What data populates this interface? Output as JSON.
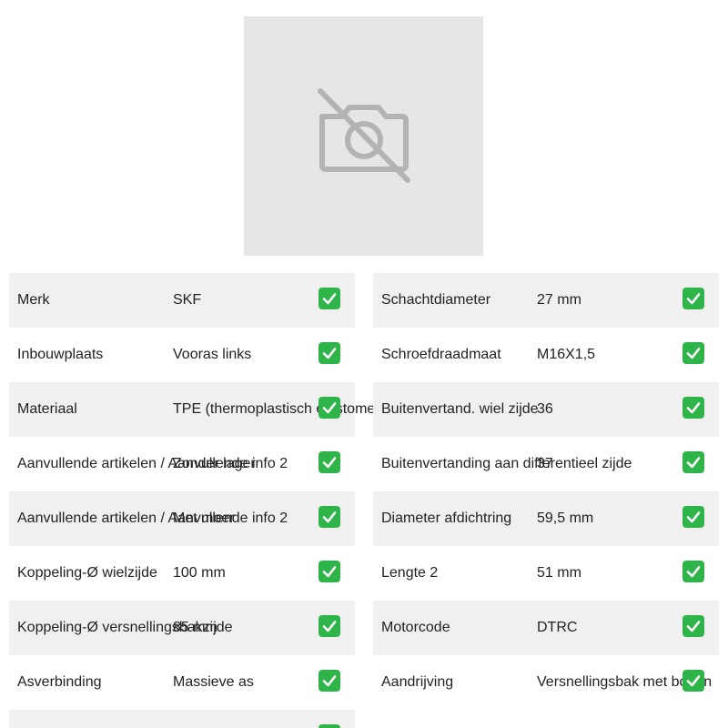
{
  "colors": {
    "row_shade": "#f0f0f0",
    "check_green": "#2fb44a",
    "placeholder_bg": "#e6e6e6",
    "placeholder_icon": "#b3b3b3"
  },
  "image": {
    "icon": "no-camera-icon"
  },
  "specs_left": [
    {
      "label": "Merk",
      "value": "SKF",
      "shaded": true
    },
    {
      "label": "Inbouwplaats",
      "value": "Vooras links",
      "shaded": false
    },
    {
      "label": "Materiaal",
      "value": "TPE (thermoplastisch elastomeer)",
      "shaded": true
    },
    {
      "label": "Aanvullende artikelen / Aanvullende info 2",
      "value": "Zonder lager",
      "shaded": false
    },
    {
      "label": "Aanvullende artikelen / Aanvullende info 2",
      "value": "Met moer",
      "shaded": true
    },
    {
      "label": "Koppeling-Ø wielzijde",
      "value": "100 mm",
      "shaded": false
    },
    {
      "label": "Koppeling-Ø versnellingsbakzijde",
      "value": "85 mm",
      "shaded": true
    },
    {
      "label": "Asverbinding",
      "value": "Massieve as",
      "shaded": false
    },
    {
      "label": "",
      "value": "",
      "shaded": true
    }
  ],
  "specs_right": [
    {
      "label": "Schachtdiameter",
      "value": "27 mm",
      "shaded": true
    },
    {
      "label": "Schroefdraadmaat",
      "value": "M16X1,5",
      "shaded": false
    },
    {
      "label": "Buitenvertand. wiel zijde",
      "value": "36",
      "shaded": true
    },
    {
      "label": "Buitenvertanding aan differentieel zijde",
      "value": "37",
      "shaded": false
    },
    {
      "label": "Diameter afdichtring",
      "value": "59,5 mm",
      "shaded": true
    },
    {
      "label": "Lengte 2",
      "value": "51 mm",
      "shaded": false
    },
    {
      "label": "Motorcode",
      "value": "DTRC",
      "shaded": true
    },
    {
      "label": "Aandrijving",
      "value": "Versnellingsbak met boben",
      "shaded": false
    }
  ]
}
